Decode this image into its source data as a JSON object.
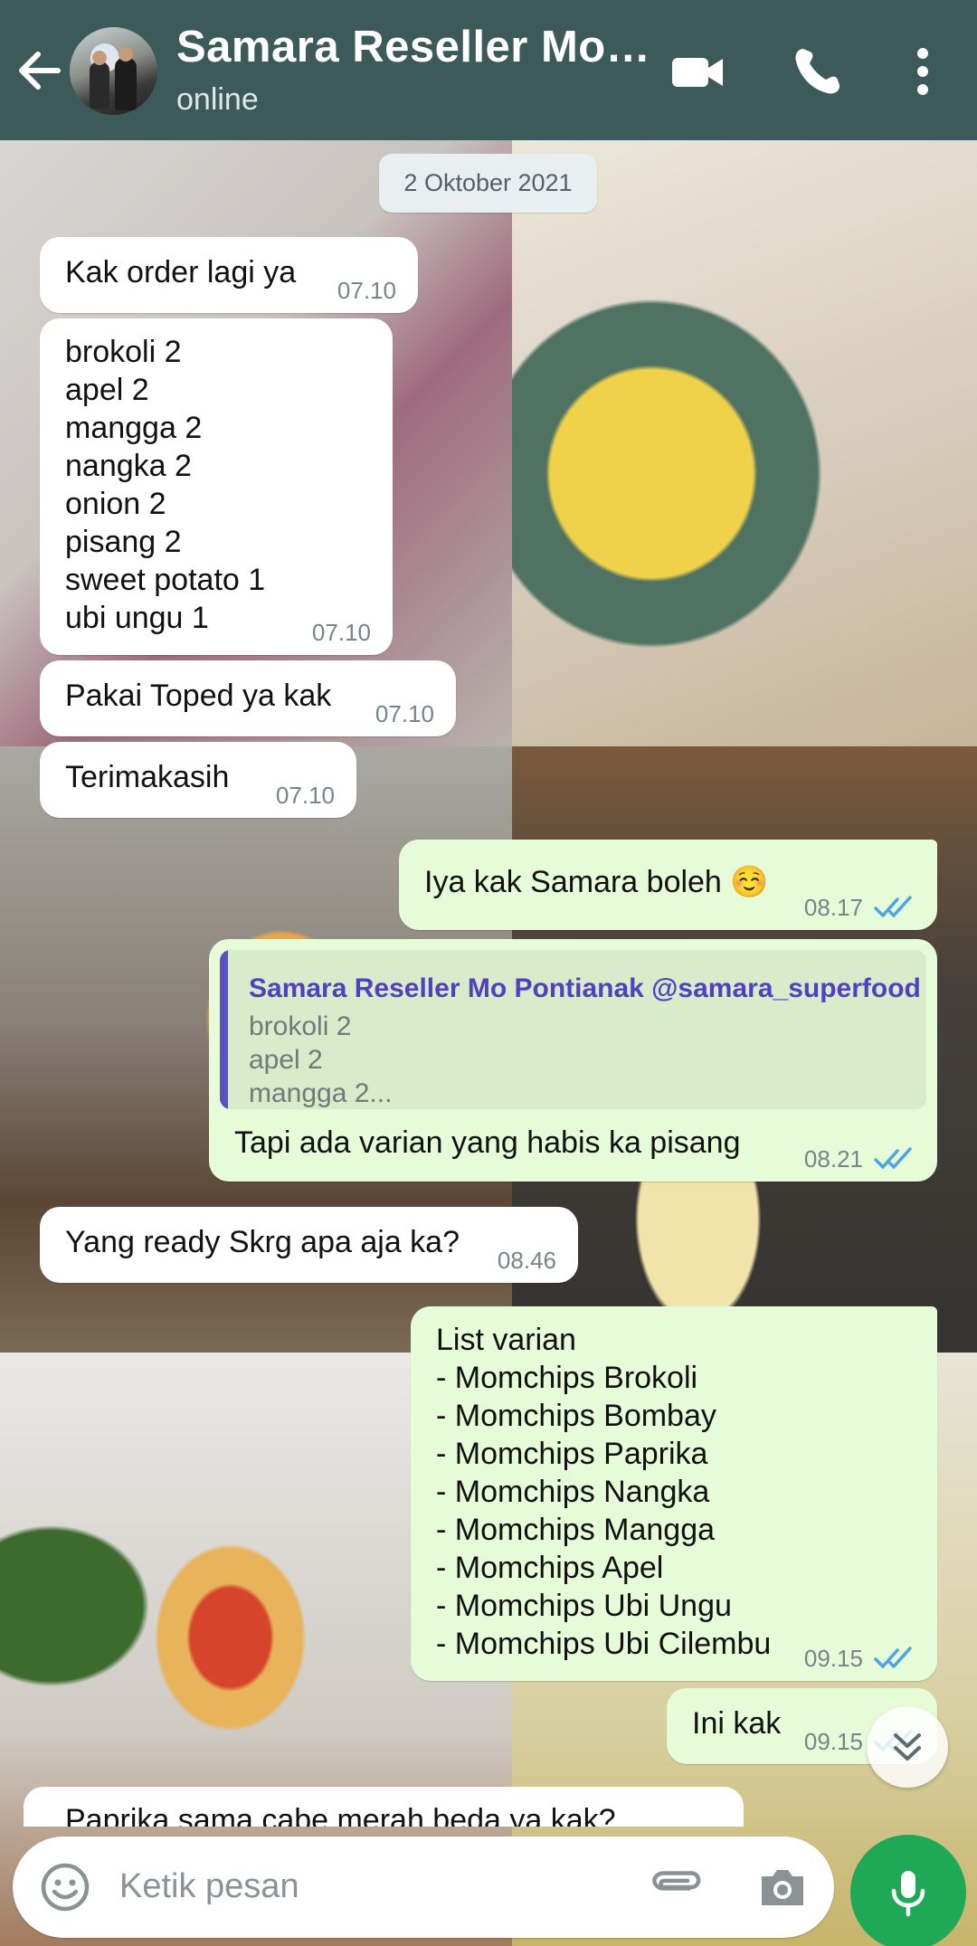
{
  "header": {
    "contact_name": "Samara Reseller Mo…",
    "status": "online",
    "icons": [
      "back-arrow-icon",
      "video-call-icon",
      "phone-icon",
      "more-options-icon"
    ]
  },
  "date_separator": "2 Oktober 2021",
  "messages": [
    {
      "direction": "in",
      "text": "Kak order lagi ya",
      "time": "07.10"
    },
    {
      "direction": "in",
      "text": "brokoli 2\napel 2\nmangga 2\nnangka 2\nonion 2\npisang 2\nsweet potato 1\nubi ungu 1",
      "time": "07.10"
    },
    {
      "direction": "in",
      "text": "Pakai Toped ya kak",
      "time": "07.10"
    },
    {
      "direction": "in",
      "text": "Terimakasih",
      "time": "07.10"
    },
    {
      "direction": "out",
      "text": "Iya kak Samara boleh ☺️",
      "time": "08.17",
      "read": true
    },
    {
      "direction": "out",
      "quote": {
        "author": "Samara Reseller Mo Pontianak @samara_superfood",
        "text": "brokoli 2\napel 2\nmangga 2..."
      },
      "text": "Tapi ada varian yang habis ka pisang",
      "time": "08.21",
      "read": true
    },
    {
      "direction": "in",
      "text": "Yang ready Skrg apa aja ka?",
      "time": "08.46"
    },
    {
      "direction": "out",
      "text": "List varian\n- Momchips Brokoli\n- Momchips Bombay\n- Momchips Paprika\n- Momchips Nangka\n- Momchips Mangga\n- Momchips Apel\n- Momchips Ubi Ungu\n- Momchips Ubi Cilembu",
      "time": "09.15",
      "read": true
    },
    {
      "direction": "out",
      "text": "Ini kak",
      "time": "09.15",
      "read": true
    },
    {
      "direction": "in",
      "text": "Paprika sama cabe merah beda ya kak?",
      "time": ""
    }
  ],
  "composer": {
    "placeholder": "Ketik pesan",
    "icons": [
      "emoji-icon",
      "attach-icon",
      "camera-icon",
      "mic-icon"
    ]
  },
  "colors": {
    "header_bg": "#3b5a59",
    "incoming_bubble": "#ffffff",
    "outgoing_bubble": "#e6fcd9",
    "read_ticks": "#4fa3e0",
    "mic_button": "#1fa855",
    "quote_author": "#5240c4"
  }
}
